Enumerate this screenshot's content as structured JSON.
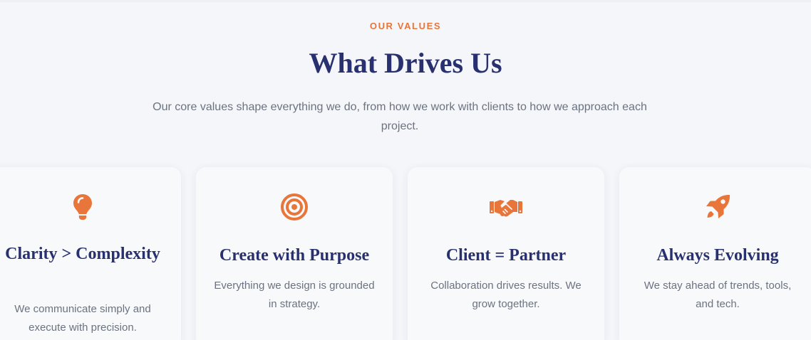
{
  "header": {
    "eyebrow": "OUR VALUES",
    "title": "What Drives Us",
    "subtitle": "Our core values shape everything we do, from how we work with clients to how we approach each project."
  },
  "values": [
    {
      "icon": "lightbulb-icon",
      "title": "Clarity > Complexity",
      "text": "We communicate simply and execute with precision."
    },
    {
      "icon": "target-icon",
      "title": "Create with Purpose",
      "text": "Everything we design is grounded in strategy."
    },
    {
      "icon": "handshake-icon",
      "title": "Client = Partner",
      "text": "Collaboration drives results. We grow together."
    },
    {
      "icon": "rocket-icon",
      "title": "Always Evolving",
      "text": "We stay ahead of trends, tools, and tech."
    }
  ],
  "colors": {
    "accent": "#e8753a",
    "heading": "#28306f",
    "body_text": "#6b7280",
    "background": "#f5f6f9"
  }
}
